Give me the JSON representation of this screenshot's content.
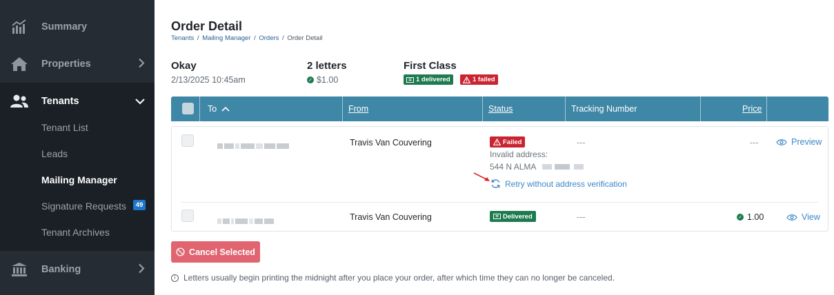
{
  "sidebar": {
    "items": [
      {
        "label": "Summary",
        "icon": "chart-icon"
      },
      {
        "label": "Properties",
        "icon": "home-icon"
      },
      {
        "label": "Tenants",
        "icon": "users-icon"
      },
      {
        "label": "Banking",
        "icon": "bank-icon"
      }
    ],
    "tenant_sub": [
      {
        "label": "Tenant List"
      },
      {
        "label": "Leads"
      },
      {
        "label": "Mailing Manager"
      },
      {
        "label": "Signature Requests",
        "badge": "49"
      },
      {
        "label": "Tenant Archives"
      }
    ]
  },
  "page": {
    "title": "Order Detail",
    "breadcrumb": [
      "Tenants",
      "Mailing Manager",
      "Orders",
      "Order Detail"
    ],
    "breadcrumb_sep": "/"
  },
  "summary": {
    "name": "Okay",
    "date": "2/13/2025 10:45am",
    "letters": "2 letters",
    "price": "$1.00",
    "mail_class": "First Class",
    "delivered_badge": "1 delivered",
    "failed_badge": "1 failed"
  },
  "table": {
    "columns": {
      "to": "To",
      "from": "From",
      "status": "Status",
      "tracking": "Tracking Number",
      "price": "Price"
    },
    "rows": [
      {
        "from": "Travis Van Couvering",
        "status": "Failed",
        "status_detail": "Invalid address:",
        "address": "544 N ALMA",
        "retry_label": "Retry without address verification",
        "tracking": "---",
        "price": "---",
        "action": "Preview"
      },
      {
        "from": "Travis Van Couvering",
        "status": "Delivered",
        "tracking": "---",
        "price": "1.00",
        "action": "View"
      }
    ]
  },
  "actions": {
    "cancel_label": "Cancel Selected"
  },
  "note": "Letters usually begin printing the midnight after you place your order, after which time they can no longer be canceled.",
  "colors": {
    "sidebar_bg": "#262c33",
    "header_bg": "#3f87a6",
    "success": "#1e7a4f",
    "danger": "#c9242f",
    "link": "#3d87c9",
    "cancel_bg": "#e06570"
  }
}
